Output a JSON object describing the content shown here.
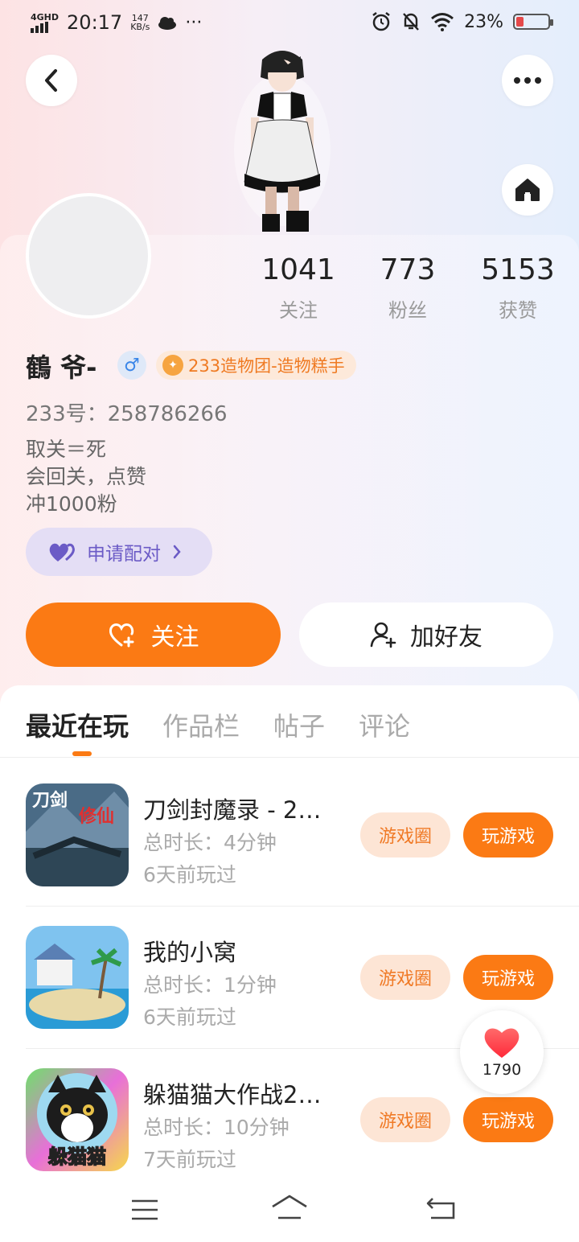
{
  "status_bar": {
    "network": "4GHD",
    "time": "20:17",
    "speed_value": "147",
    "speed_unit": "KB/s",
    "dots": "···",
    "battery": "23%",
    "battery_level": 0.23
  },
  "header": {
    "back_icon": "chevron-left-icon",
    "more_icon": "more-dots-icon",
    "home_icon": "home-icon"
  },
  "profile": {
    "stats": [
      {
        "value": "1041",
        "label": "关注"
      },
      {
        "value": "773",
        "label": "粉丝"
      },
      {
        "value": "5153",
        "label": "获赞"
      }
    ],
    "name": "鶴 爷-",
    "gender_symbol": "♂",
    "badge_text": "233造物团-造物糕手",
    "uid": "233号：258786266",
    "bio": [
      "取关＝死",
      "会回关，点赞",
      "冲1000粉"
    ],
    "pair_label": "申请配对",
    "follow_label": "关注",
    "add_friend_label": "加好友"
  },
  "tabs": [
    {
      "label": "最近在玩",
      "active": true
    },
    {
      "label": "作品栏",
      "active": false
    },
    {
      "label": "帖子",
      "active": false
    },
    {
      "label": "评论",
      "active": false
    }
  ],
  "games": [
    {
      "title": "刀剑封魔录 - 2…",
      "duration": "总时长：4分钟",
      "last_played": "6天前玩过",
      "circle_label": "游戏圈",
      "play_label": "玩游戏"
    },
    {
      "title": "我的小窝",
      "duration": "总时长：1分钟",
      "last_played": "6天前玩过",
      "circle_label": "游戏圈",
      "play_label": "玩游戏"
    },
    {
      "title": "躲猫猫大作战2…",
      "duration": "总时长：10分钟",
      "last_played": "7天前玩过",
      "circle_label": "游戏圈",
      "play_label": "玩游戏",
      "icon_text": "躲猫猫"
    }
  ],
  "game_icon_texts": {
    "game0_a": "刀剑",
    "game0_b": "修仙"
  },
  "floating_like": {
    "count": "1790"
  },
  "colors": {
    "accent": "#fb7a14",
    "pair_purple": "#6b5bc6"
  }
}
